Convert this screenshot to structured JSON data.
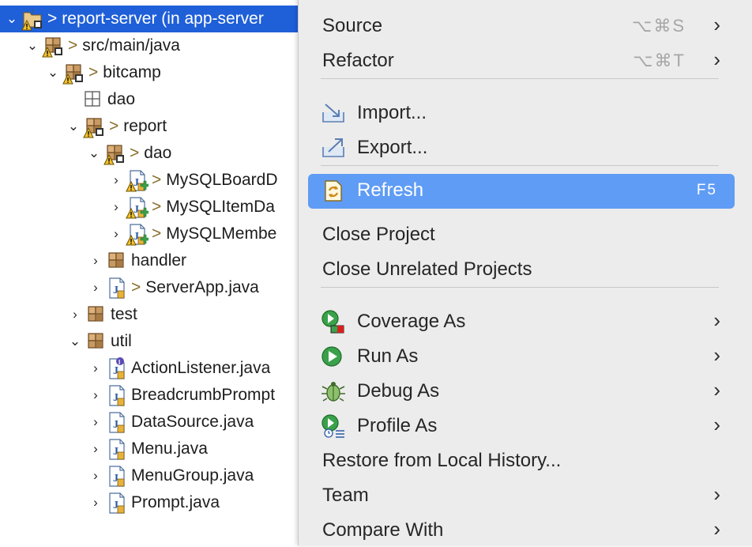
{
  "tree": [
    {
      "twisty": "⌄",
      "prefix": ">",
      "label": "report-server (in app-server",
      "icon": "project-icon",
      "selected": true
    },
    {
      "twisty": "⌄",
      "prefix": ">",
      "label": "src/main/java",
      "icon": "source-folder-warning-icon"
    },
    {
      "twisty": "⌄",
      "prefix": ">",
      "label": "bitcamp",
      "icon": "package-warning-icon"
    },
    {
      "twisty": "",
      "prefix": "",
      "label": "dao",
      "icon": "empty-package-icon"
    },
    {
      "twisty": "⌄",
      "prefix": ">",
      "label": "report",
      "icon": "package-warning-icon"
    },
    {
      "twisty": "⌄",
      "prefix": ">",
      "label": "dao",
      "icon": "package-warning-icon"
    },
    {
      "twisty": "›",
      "prefix": ">",
      "label": "MySQLBoardD",
      "icon": "java-file-new-warning-icon"
    },
    {
      "twisty": "›",
      "prefix": ">",
      "label": "MySQLItemDa",
      "icon": "java-file-new-warning-icon"
    },
    {
      "twisty": "›",
      "prefix": ">",
      "label": "MySQLMembe",
      "icon": "java-file-new-warning-icon"
    },
    {
      "twisty": "›",
      "prefix": "",
      "label": "handler",
      "icon": "package-icon"
    },
    {
      "twisty": "›",
      "prefix": ">",
      "label": "ServerApp.java",
      "icon": "java-file-icon"
    },
    {
      "twisty": "›",
      "prefix": "",
      "label": "test",
      "icon": "package-icon"
    },
    {
      "twisty": "⌄",
      "prefix": "",
      "label": "util",
      "icon": "package-icon"
    },
    {
      "twisty": "›",
      "prefix": "",
      "label": "ActionListener.java",
      "icon": "java-interface-file-icon"
    },
    {
      "twisty": "›",
      "prefix": "",
      "label": "BreadcrumbPrompt",
      "icon": "java-file-icon"
    },
    {
      "twisty": "›",
      "prefix": "",
      "label": "DataSource.java",
      "icon": "java-file-icon"
    },
    {
      "twisty": "›",
      "prefix": "",
      "label": "Menu.java",
      "icon": "java-file-icon"
    },
    {
      "twisty": "›",
      "prefix": "",
      "label": "MenuGroup.java",
      "icon": "java-file-icon"
    },
    {
      "twisty": "›",
      "prefix": "",
      "label": "Prompt.java",
      "icon": "java-file-icon"
    }
  ],
  "menu": {
    "source": {
      "label": "Source",
      "shortcut": "⌥⌘S"
    },
    "refactor": {
      "label": "Refactor",
      "shortcut": "⌥⌘T"
    },
    "import": {
      "label": "Import..."
    },
    "export": {
      "label": "Export..."
    },
    "refresh": {
      "label": "Refresh",
      "shortcut": "F5"
    },
    "close_project": {
      "label": "Close Project"
    },
    "close_unrelated": {
      "label": "Close Unrelated Projects"
    },
    "coverage_as": {
      "label": "Coverage As"
    },
    "run_as": {
      "label": "Run As"
    },
    "debug_as": {
      "label": "Debug As"
    },
    "profile_as": {
      "label": "Profile As"
    },
    "restore_history": {
      "label": "Restore from Local History..."
    },
    "team": {
      "label": "Team"
    },
    "compare_with": {
      "label": "Compare With"
    },
    "submenu_arrow": "›"
  },
  "colors": {
    "selection": "#1f5fd8",
    "menu_highlight": "#5f9cf5",
    "menu_bg": "#ececec"
  }
}
